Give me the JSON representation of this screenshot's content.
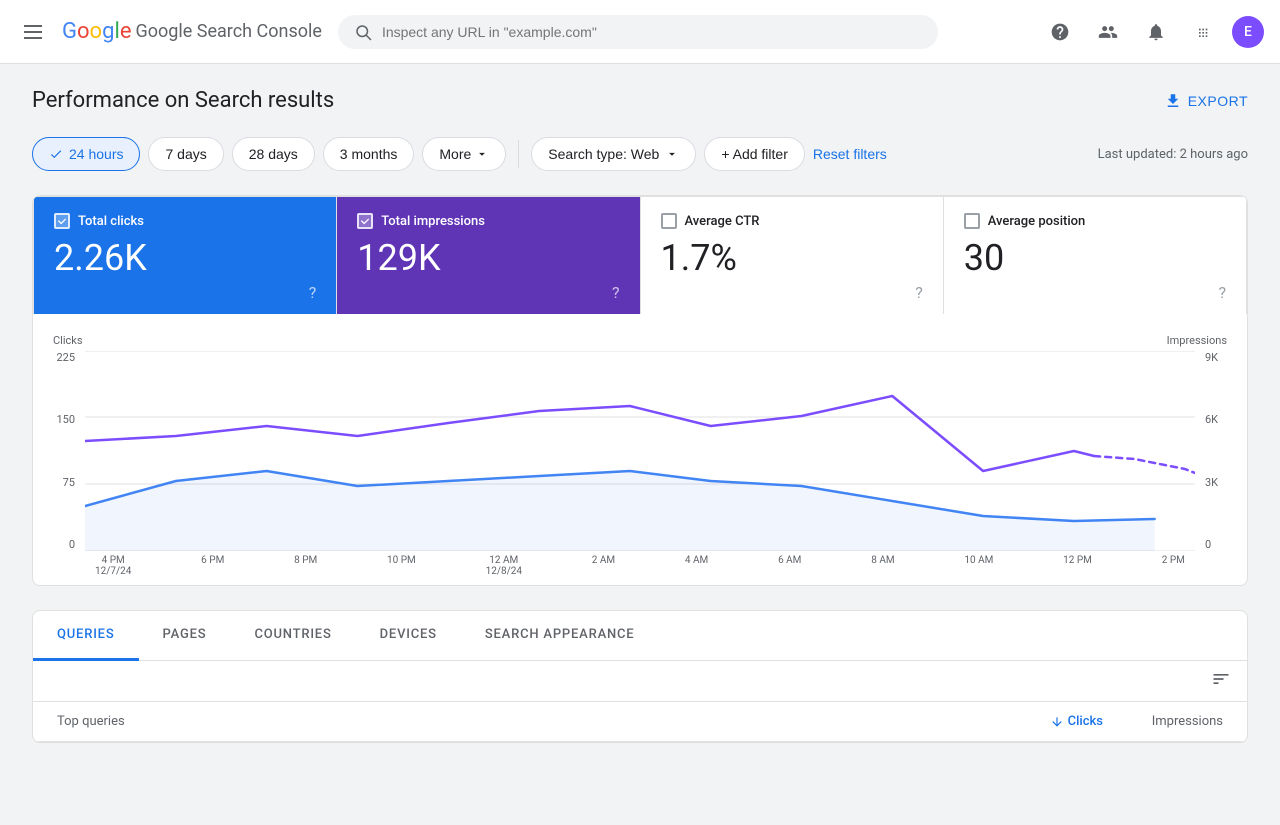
{
  "app": {
    "title": "Google Search Console",
    "logo_google": "Google",
    "logo_app": "Search Console"
  },
  "header": {
    "search_placeholder": "Inspect any URL in \"example.com\"",
    "user_initial": "E"
  },
  "page": {
    "title": "Performance on Search results",
    "export_label": "EXPORT",
    "last_updated": "Last updated: 2 hours ago"
  },
  "filters": {
    "time_options": [
      {
        "label": "24 hours",
        "active": true
      },
      {
        "label": "7 days",
        "active": false
      },
      {
        "label": "28 days",
        "active": false
      },
      {
        "label": "3 months",
        "active": false
      },
      {
        "label": "More",
        "active": false
      }
    ],
    "search_type_label": "Search type: Web",
    "add_filter_label": "+ Add filter",
    "reset_label": "Reset filters"
  },
  "metrics": [
    {
      "id": "total-clicks",
      "label": "Total clicks",
      "value": "2.26K",
      "active": true,
      "theme": "blue"
    },
    {
      "id": "total-impressions",
      "label": "Total impressions",
      "value": "129K",
      "active": true,
      "theme": "purple"
    },
    {
      "id": "average-ctr",
      "label": "Average CTR",
      "value": "1.7%",
      "active": false,
      "theme": "neutral"
    },
    {
      "id": "average-position",
      "label": "Average position",
      "value": "30",
      "active": false,
      "theme": "neutral"
    }
  ],
  "chart": {
    "y_left_label": "Clicks",
    "y_right_label": "Impressions",
    "y_left_ticks": [
      "225",
      "150",
      "75",
      "0"
    ],
    "y_right_ticks": [
      "9K",
      "6K",
      "3K",
      "0"
    ],
    "x_labels": [
      {
        "time": "4 PM",
        "date": "12/7/24"
      },
      {
        "time": "6 PM",
        "date": ""
      },
      {
        "time": "8 PM",
        "date": ""
      },
      {
        "time": "10 PM",
        "date": ""
      },
      {
        "time": "12 AM",
        "date": "12/8/24"
      },
      {
        "time": "2 AM",
        "date": ""
      },
      {
        "time": "4 AM",
        "date": ""
      },
      {
        "time": "6 AM",
        "date": ""
      },
      {
        "time": "8 AM",
        "date": ""
      },
      {
        "time": "10 AM",
        "date": ""
      },
      {
        "time": "12 PM",
        "date": ""
      },
      {
        "time": "2 PM",
        "date": ""
      }
    ]
  },
  "tabs": {
    "items": [
      {
        "label": "QUERIES",
        "active": true
      },
      {
        "label": "PAGES",
        "active": false
      },
      {
        "label": "COUNTRIES",
        "active": false
      },
      {
        "label": "DEVICES",
        "active": false
      },
      {
        "label": "SEARCH APPEARANCE",
        "active": false
      }
    ],
    "table_header": {
      "queries_label": "Top queries",
      "clicks_label": "Clicks",
      "impressions_label": "Impressions"
    }
  }
}
